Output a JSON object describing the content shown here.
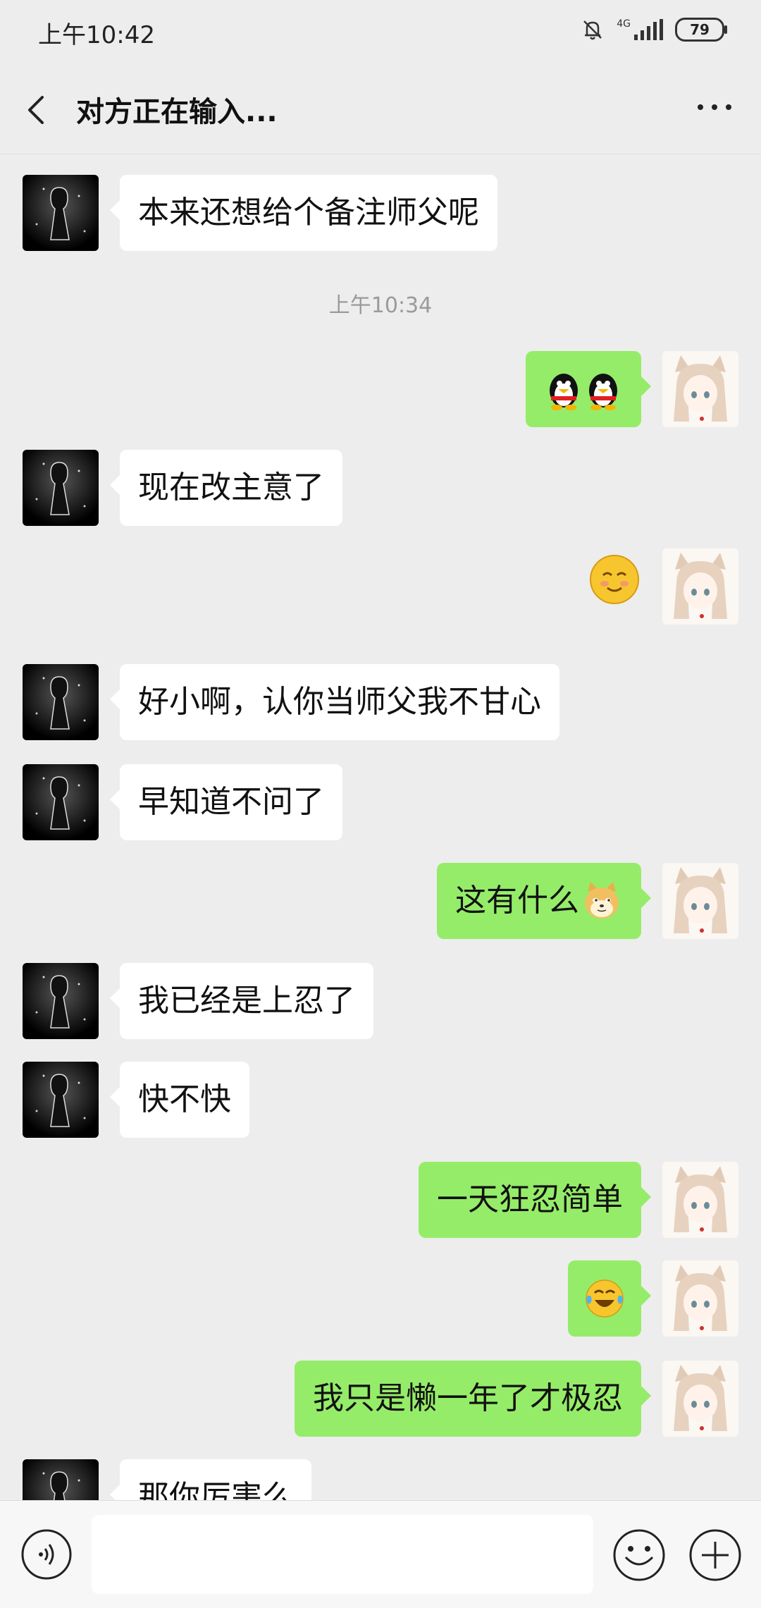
{
  "status_bar": {
    "time": "上午10:42",
    "network": "4G",
    "battery": "79"
  },
  "header": {
    "title": "对方正在输入..."
  },
  "messages": [
    {
      "text": "本来还想给个备注师父呢"
    },
    {
      "timestamp": "上午10:34"
    },
    {
      "emoji": "qq-penguin-sticker"
    },
    {
      "text": "现在改主意了"
    },
    {
      "emoji": "smiling-sticker"
    },
    {
      "text": "好小啊，认你当师父我不甘心"
    },
    {
      "text": "早知道不问了"
    },
    {
      "text": "这有什么",
      "emoji": "doge-emoji"
    },
    {
      "text": "我已经是上忍了"
    },
    {
      "text": "快不快"
    },
    {
      "text": "一天狂忍简单"
    },
    {
      "emoji": "tears-of-joy-emoji"
    },
    {
      "text": "我只是懒一年了才极忍"
    },
    {
      "text": "那你厉害么"
    }
  ],
  "colors": {
    "outgoing_bubble": "#95ec69",
    "incoming_bubble": "#ffffff",
    "background": "#ededed"
  }
}
